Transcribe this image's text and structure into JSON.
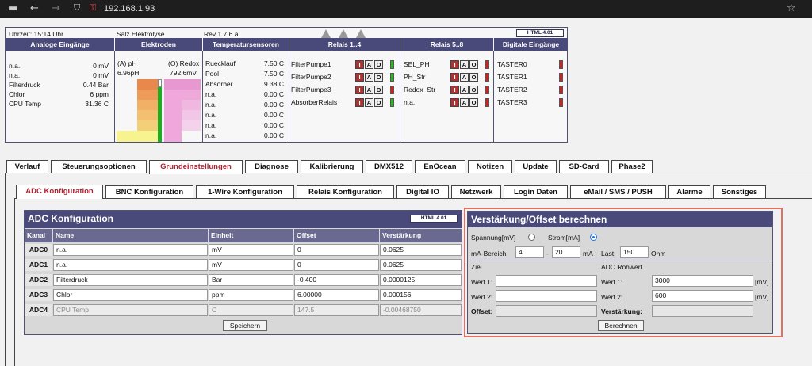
{
  "browser": {
    "url": "192.168.1.93"
  },
  "status": {
    "time": "Uhrzeit: 15:14 Uhr",
    "product": "Salz Elektrolyse",
    "rev": "Rev 1.7.6.a",
    "logo_text": "HTML 4.01",
    "headers": [
      "Analoge Eingänge",
      "Elektroden",
      "Temperatursensoren",
      "Relais 1..4",
      "Relais 5..8",
      "Digitale Eingänge"
    ],
    "analog": [
      {
        "name": "n.a.",
        "value": "0 mV"
      },
      {
        "name": "n.a.",
        "value": "0 mV"
      },
      {
        "name": "Filterdruck",
        "value": "0.44 Bar"
      },
      {
        "name": "Chlor",
        "value": "6 ppm"
      },
      {
        "name": "CPU Temp",
        "value": "31.36 C"
      }
    ],
    "electrodes": {
      "ph_label": "(A) pH",
      "redox_label": "(O) Redox",
      "ph_value": "6.96pH",
      "redox_value": "792.6mV"
    },
    "temps": [
      {
        "name": "Ruecklauf",
        "value": "7.50 C"
      },
      {
        "name": "Pool",
        "value": "7.50 C"
      },
      {
        "name": "Absorber",
        "value": "9.38 C"
      },
      {
        "name": "n.a.",
        "value": "0.00 C"
      },
      {
        "name": "n.a.",
        "value": "0.00 C"
      },
      {
        "name": "n.a.",
        "value": "0.00 C"
      },
      {
        "name": "n.a.",
        "value": "0.00 C"
      },
      {
        "name": "n.a.",
        "value": "0.00 C"
      }
    ],
    "relais1": [
      "FilterPumpe1",
      "FilterPumpe2",
      "FilterPumpe3",
      "AbsorberRelais"
    ],
    "relais2": [
      "SEL_PH",
      "PH_Str",
      "Redox_Str",
      "n.a."
    ],
    "iao": {
      "i": "I",
      "a": "A",
      "o": "O"
    },
    "digital": [
      "TASTER0",
      "TASTER1",
      "TASTER2",
      "TASTER3"
    ],
    "colors": {
      "on": "#2bb32b",
      "off": "#cc2222"
    }
  },
  "tabs1": [
    "Verlauf",
    "Steuerungsoptionen",
    "Grundeinstellungen",
    "Diagnose",
    "Kalibrierung",
    "DMX512",
    "EnOcean",
    "Notizen",
    "Update",
    "SD-Card",
    "Phase2"
  ],
  "tabs2": [
    "ADC Konfiguration",
    "BNC Konfiguration",
    "1-Wire Konfiguration",
    "Relais Konfiguration",
    "Digital IO",
    "Netzwerk",
    "Login Daten",
    "eMail / SMS / PUSH",
    "Alarme",
    "Sonstiges"
  ],
  "adc": {
    "title": "ADC Konfiguration",
    "logo_text": "HTML 4.01",
    "columns": [
      "Kanal",
      "Name",
      "Einheit",
      "Offset",
      "Verstärkung"
    ],
    "rows": [
      {
        "kanal": "ADC0",
        "name": "n.a.",
        "einheit": "mV",
        "offset": "0",
        "verstaerkung": "0.0625"
      },
      {
        "kanal": "ADC1",
        "name": "n.a.",
        "einheit": "mV",
        "offset": "0",
        "verstaerkung": "0.0625"
      },
      {
        "kanal": "ADC2",
        "name": "Filterdruck",
        "einheit": "Bar",
        "offset": "-0.400",
        "verstaerkung": "0.0000125"
      },
      {
        "kanal": "ADC3",
        "name": "Chlor",
        "einheit": "ppm",
        "offset": "6.00000",
        "verstaerkung": "0.000156"
      },
      {
        "kanal": "ADC4",
        "name": "CPU Temp",
        "einheit": "C",
        "offset": "147.5",
        "verstaerkung": "-0.00468750"
      }
    ],
    "save_label": "Speichern"
  },
  "calc": {
    "title": "Verstärkung/Offset berechnen",
    "spannung_label": "Spannung[mV]",
    "strom_label": "Strom[mA]",
    "ma_bereich_label": "mA-Bereich:",
    "ma_from": "4",
    "dash": "-",
    "ma_to": "20",
    "ma_unit": "mA",
    "last_label": "Last:",
    "last_value": "150",
    "ohm": "Ohm",
    "ziel_label": "Ziel",
    "rohwert_label": "ADC Rohwert",
    "wert1_label": "Wert 1:",
    "wert2_label": "Wert 2:",
    "raw1_label": "Wert 1:",
    "raw2_label": "Wert 2:",
    "raw1_value": "3000",
    "raw2_value": "600",
    "mv_unit": "[mV]",
    "offset_label": "Offset:",
    "gain_label": "Verstärkung:",
    "calc_label": "Berechnen"
  }
}
